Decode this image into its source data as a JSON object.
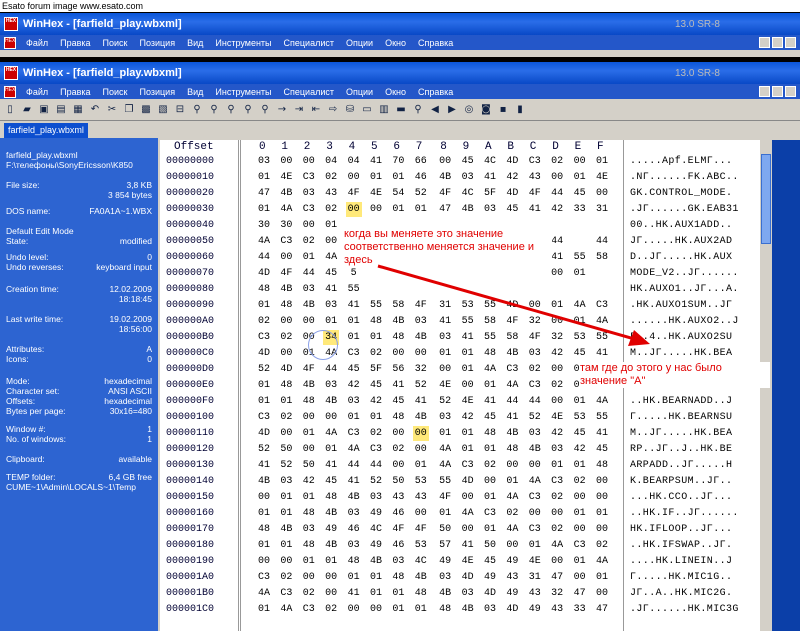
{
  "forum_caption": "Esato forum image www.esato.com",
  "app": {
    "title": "WinHex - [farfield_play.wbxml]",
    "version": "13.0 SR-8",
    "menu": [
      "Файл",
      "Правка",
      "Поиск",
      "Позиция",
      "Вид",
      "Инструменты",
      "Специалист",
      "Опции",
      "Окно",
      "Справка"
    ]
  },
  "tab_label": "farfield_play.wbxml",
  "side": {
    "filename": "farfield_play.wbxml",
    "path": "F:\\телефоны\\SonyEricsson\\K850",
    "file_size_label": "File size:",
    "file_size_kb": "3,8 KB",
    "file_size_bytes": "3 854 bytes",
    "dos_name_label": "DOS name:",
    "dos_name": "FA0A1A~1.WBX",
    "edit_mode_label": "Default Edit Mode",
    "state_label": "State:",
    "state": "modified",
    "undo_level_label": "Undo level:",
    "undo_level": "0",
    "undo_rev_label": "Undo reverses:",
    "undo_rev": "keyboard input",
    "creation_label": "Creation time:",
    "creation_date": "12.02.2009",
    "creation_time": "18:18:45",
    "lastwrite_label": "Last write time:",
    "lastwrite_date": "19.02.2009",
    "lastwrite_time": "18:56:00",
    "attributes_label": "Attributes:",
    "attributes": "A",
    "icons_label": "Icons:",
    "icons": "0",
    "mode_label": "Mode:",
    "mode": "hexadecimal",
    "charset_label": "Character set:",
    "charset": "ANSI ASCII",
    "offsets_label": "Offsets:",
    "offsets": "hexadecimal",
    "bpp_label": "Bytes per page:",
    "bpp": "30x16=480",
    "window_label": "Window #:",
    "window": "1",
    "nwin_label": "No. of windows:",
    "nwin": "1",
    "clip_label": "Clipboard:",
    "clip": "available",
    "temp_label": "TEMP folder:",
    "temp": "6,4 GB free",
    "temp_path": "CUME~1\\Admin\\LOCALS~1\\Temp"
  },
  "hex": {
    "offset_header": "Offset",
    "columns": [
      "0",
      "1",
      "2",
      "3",
      "4",
      "5",
      "6",
      "7",
      "8",
      "9",
      "A",
      "B",
      "C",
      "D",
      "E",
      "F"
    ],
    "rows": [
      {
        "off": "00000000",
        "b": [
          "03",
          "00",
          "00",
          "04",
          "04",
          "41",
          "70",
          "66",
          "00",
          "45",
          "4C",
          "4D",
          "C3",
          "02",
          "00",
          "01"
        ],
        "t": ".....Apf.ELMГ..."
      },
      {
        "off": "00000010",
        "b": [
          "01",
          "4E",
          "C3",
          "02",
          "00",
          "01",
          "01",
          "46",
          "4B",
          "03",
          "41",
          "42",
          "43",
          "00",
          "01",
          "4E"
        ],
        "t": ".NГ......FK.ABC.."
      },
      {
        "off": "00000020",
        "b": [
          "47",
          "4B",
          "03",
          "43",
          "4F",
          "4E",
          "54",
          "52",
          "4F",
          "4C",
          "5F",
          "4D",
          "4F",
          "44",
          "45",
          "00"
        ],
        "t": "GK.CONTROL_MODE."
      },
      {
        "off": "00000030",
        "b": [
          "01",
          "4A",
          "C3",
          "02",
          "00",
          "00",
          "01",
          "01",
          "47",
          "4B",
          "03",
          "45",
          "41",
          "42",
          "33",
          "31"
        ],
        "t": ".JГ......GK.EAB31"
      },
      {
        "off": "00000040",
        "b": [
          "30",
          "30",
          "00",
          "01",
          "",
          "",
          "",
          "",
          "",
          "",
          "",
          "",
          "",
          "",
          "",
          ""
        ],
        "t": "00..HK.AUX1ADD.."
      },
      {
        "off": "00000050",
        "b": [
          "4A",
          "C3",
          "02",
          "00",
          "",
          "",
          "",
          "",
          "",
          "",
          "",
          "",
          "41",
          "44",
          "",
          "44"
        ],
        "t": "JГ.....HK.AUX2AD"
      },
      {
        "off": "00000060",
        "b": [
          "44",
          "00",
          "01",
          "4A",
          "",
          "",
          "",
          "",
          "",
          "",
          "",
          "",
          "",
          "41",
          "55",
          "58"
        ],
        "t": "D..JГ.....HK.AUX"
      },
      {
        "off": "00000070",
        "b": [
          "4D",
          "4F",
          "44",
          "45",
          "5",
          "",
          "",
          "",
          "",
          "",
          "",
          "",
          "",
          "00",
          "01",
          ""
        ],
        "t": "MODE_V2..JГ......"
      },
      {
        "off": "00000080",
        "b": [
          "48",
          "4B",
          "03",
          "41",
          "55",
          "",
          "",
          "",
          "",
          "",
          "",
          "",
          "",
          "",
          "",
          ""
        ],
        "t": "HK.AUXO1..JГ...A."
      },
      {
        "off": "00000090",
        "b": [
          "01",
          "48",
          "4B",
          "03",
          "41",
          "55",
          "58",
          "4F",
          "31",
          "53",
          "55",
          "4D",
          "00",
          "01",
          "4A",
          "C3"
        ],
        "t": ".HK.AUXO1SUM..JГ"
      },
      {
        "off": "000000A0",
        "b": [
          "02",
          "00",
          "00",
          "01",
          "01",
          "48",
          "4B",
          "03",
          "41",
          "55",
          "58",
          "4F",
          "32",
          "00",
          "01",
          "4A"
        ],
        "t": "......HK.AUXO2..J"
      },
      {
        "off": "000000B0",
        "b": [
          "C3",
          "02",
          "00",
          "34",
          "01",
          "01",
          "48",
          "4B",
          "03",
          "41",
          "55",
          "58",
          "4F",
          "32",
          "53",
          "55"
        ],
        "t": "Г..4..HK.AUXO2SU"
      },
      {
        "off": "000000C0",
        "b": [
          "4D",
          "00",
          "01",
          "4A",
          "C3",
          "02",
          "00",
          "00",
          "01",
          "01",
          "48",
          "4B",
          "03",
          "42",
          "45",
          "41"
        ],
        "t": "M..JГ.....HK.BEA"
      },
      {
        "off": "000000D0",
        "b": [
          "52",
          "4D",
          "4F",
          "44",
          "45",
          "5F",
          "56",
          "32",
          "00",
          "01",
          "4A",
          "C3",
          "02",
          "00",
          "00",
          "01"
        ],
        "t": "RMODE_V2..JГ....."
      },
      {
        "off": "000000E0",
        "b": [
          "01",
          "48",
          "4B",
          "03",
          "42",
          "45",
          "41",
          "52",
          "4E",
          "00",
          "01",
          "4A",
          "C3",
          "02",
          "00",
          "CA"
        ],
        "t": ".HK.BEARN..JГ..К"
      },
      {
        "off": "000000F0",
        "b": [
          "01",
          "01",
          "48",
          "4B",
          "03",
          "42",
          "45",
          "41",
          "52",
          "4E",
          "41",
          "44",
          "44",
          "00",
          "01",
          "4A"
        ],
        "t": "..HK.BEARNADD..J"
      },
      {
        "off": "00000100",
        "b": [
          "C3",
          "02",
          "00",
          "00",
          "01",
          "01",
          "48",
          "4B",
          "03",
          "42",
          "45",
          "41",
          "52",
          "4E",
          "53",
          "55"
        ],
        "t": "Г.....HK.BEARNSU"
      },
      {
        "off": "00000110",
        "b": [
          "4D",
          "00",
          "01",
          "4A",
          "C3",
          "02",
          "00",
          "00",
          "01",
          "01",
          "48",
          "4B",
          "03",
          "42",
          "45",
          "41"
        ],
        "t": "M..JГ.....HK.BEA"
      },
      {
        "off": "00000120",
        "b": [
          "52",
          "50",
          "00",
          "01",
          "4A",
          "C3",
          "02",
          "00",
          "4A",
          "01",
          "01",
          "48",
          "4B",
          "03",
          "42",
          "45"
        ],
        "t": "RP..JГ..J..HK.BE"
      },
      {
        "off": "00000130",
        "b": [
          "41",
          "52",
          "50",
          "41",
          "44",
          "44",
          "00",
          "01",
          "4A",
          "C3",
          "02",
          "00",
          "00",
          "01",
          "01",
          "48"
        ],
        "t": "ARPADD..JГ.....H"
      },
      {
        "off": "00000140",
        "b": [
          "4B",
          "03",
          "42",
          "45",
          "41",
          "52",
          "50",
          "53",
          "55",
          "4D",
          "00",
          "01",
          "4A",
          "C3",
          "02",
          "00"
        ],
        "t": "K.BEARPSUM..JГ.."
      },
      {
        "off": "00000150",
        "b": [
          "00",
          "01",
          "01",
          "48",
          "4B",
          "03",
          "43",
          "43",
          "4F",
          "00",
          "01",
          "4A",
          "C3",
          "02",
          "00",
          "00"
        ],
        "t": "...HK.CCO..JГ..."
      },
      {
        "off": "00000160",
        "b": [
          "01",
          "01",
          "48",
          "4B",
          "03",
          "49",
          "46",
          "00",
          "01",
          "4A",
          "C3",
          "02",
          "00",
          "00",
          "01",
          "01"
        ],
        "t": "..HK.IF..JГ......"
      },
      {
        "off": "00000170",
        "b": [
          "48",
          "4B",
          "03",
          "49",
          "46",
          "4C",
          "4F",
          "4F",
          "50",
          "00",
          "01",
          "4A",
          "C3",
          "02",
          "00",
          "00"
        ],
        "t": "HK.IFLOOP..JГ..."
      },
      {
        "off": "00000180",
        "b": [
          "01",
          "01",
          "48",
          "4B",
          "03",
          "49",
          "46",
          "53",
          "57",
          "41",
          "50",
          "00",
          "01",
          "4A",
          "C3",
          "02"
        ],
        "t": "..HK.IFSWAP..JГ."
      },
      {
        "off": "00000190",
        "b": [
          "00",
          "00",
          "01",
          "01",
          "48",
          "4B",
          "03",
          "4C",
          "49",
          "4E",
          "45",
          "49",
          "4E",
          "00",
          "01",
          "4A"
        ],
        "t": "....HK.LINEIN..J"
      },
      {
        "off": "000001A0",
        "b": [
          "C3",
          "02",
          "00",
          "00",
          "01",
          "01",
          "48",
          "4B",
          "03",
          "4D",
          "49",
          "43",
          "31",
          "47",
          "00",
          "01"
        ],
        "t": "Г.....HK.MIC1G.."
      },
      {
        "off": "000001B0",
        "b": [
          "4A",
          "C3",
          "02",
          "00",
          "41",
          "01",
          "01",
          "48",
          "4B",
          "03",
          "4D",
          "49",
          "43",
          "32",
          "47",
          "00"
        ],
        "t": "JГ..A..HK.MIC2G."
      },
      {
        "off": "000001C0",
        "b": [
          "01",
          "4A",
          "C3",
          "02",
          "00",
          "00",
          "01",
          "01",
          "48",
          "4B",
          "03",
          "4D",
          "49",
          "43",
          "33",
          "47"
        ],
        "t": ".JГ......HK.MIC3G"
      }
    ]
  },
  "annotations": {
    "top": "когда вы меняете это значение соответственно меняется значение и здесь",
    "bottom": "там где до этого у нас было значение \"A\""
  },
  "colors": {
    "title_blue": "#0a56d9",
    "side_blue": "#2d64d1",
    "annotation_red": "#e00000",
    "highlight": "#ffe97a"
  }
}
